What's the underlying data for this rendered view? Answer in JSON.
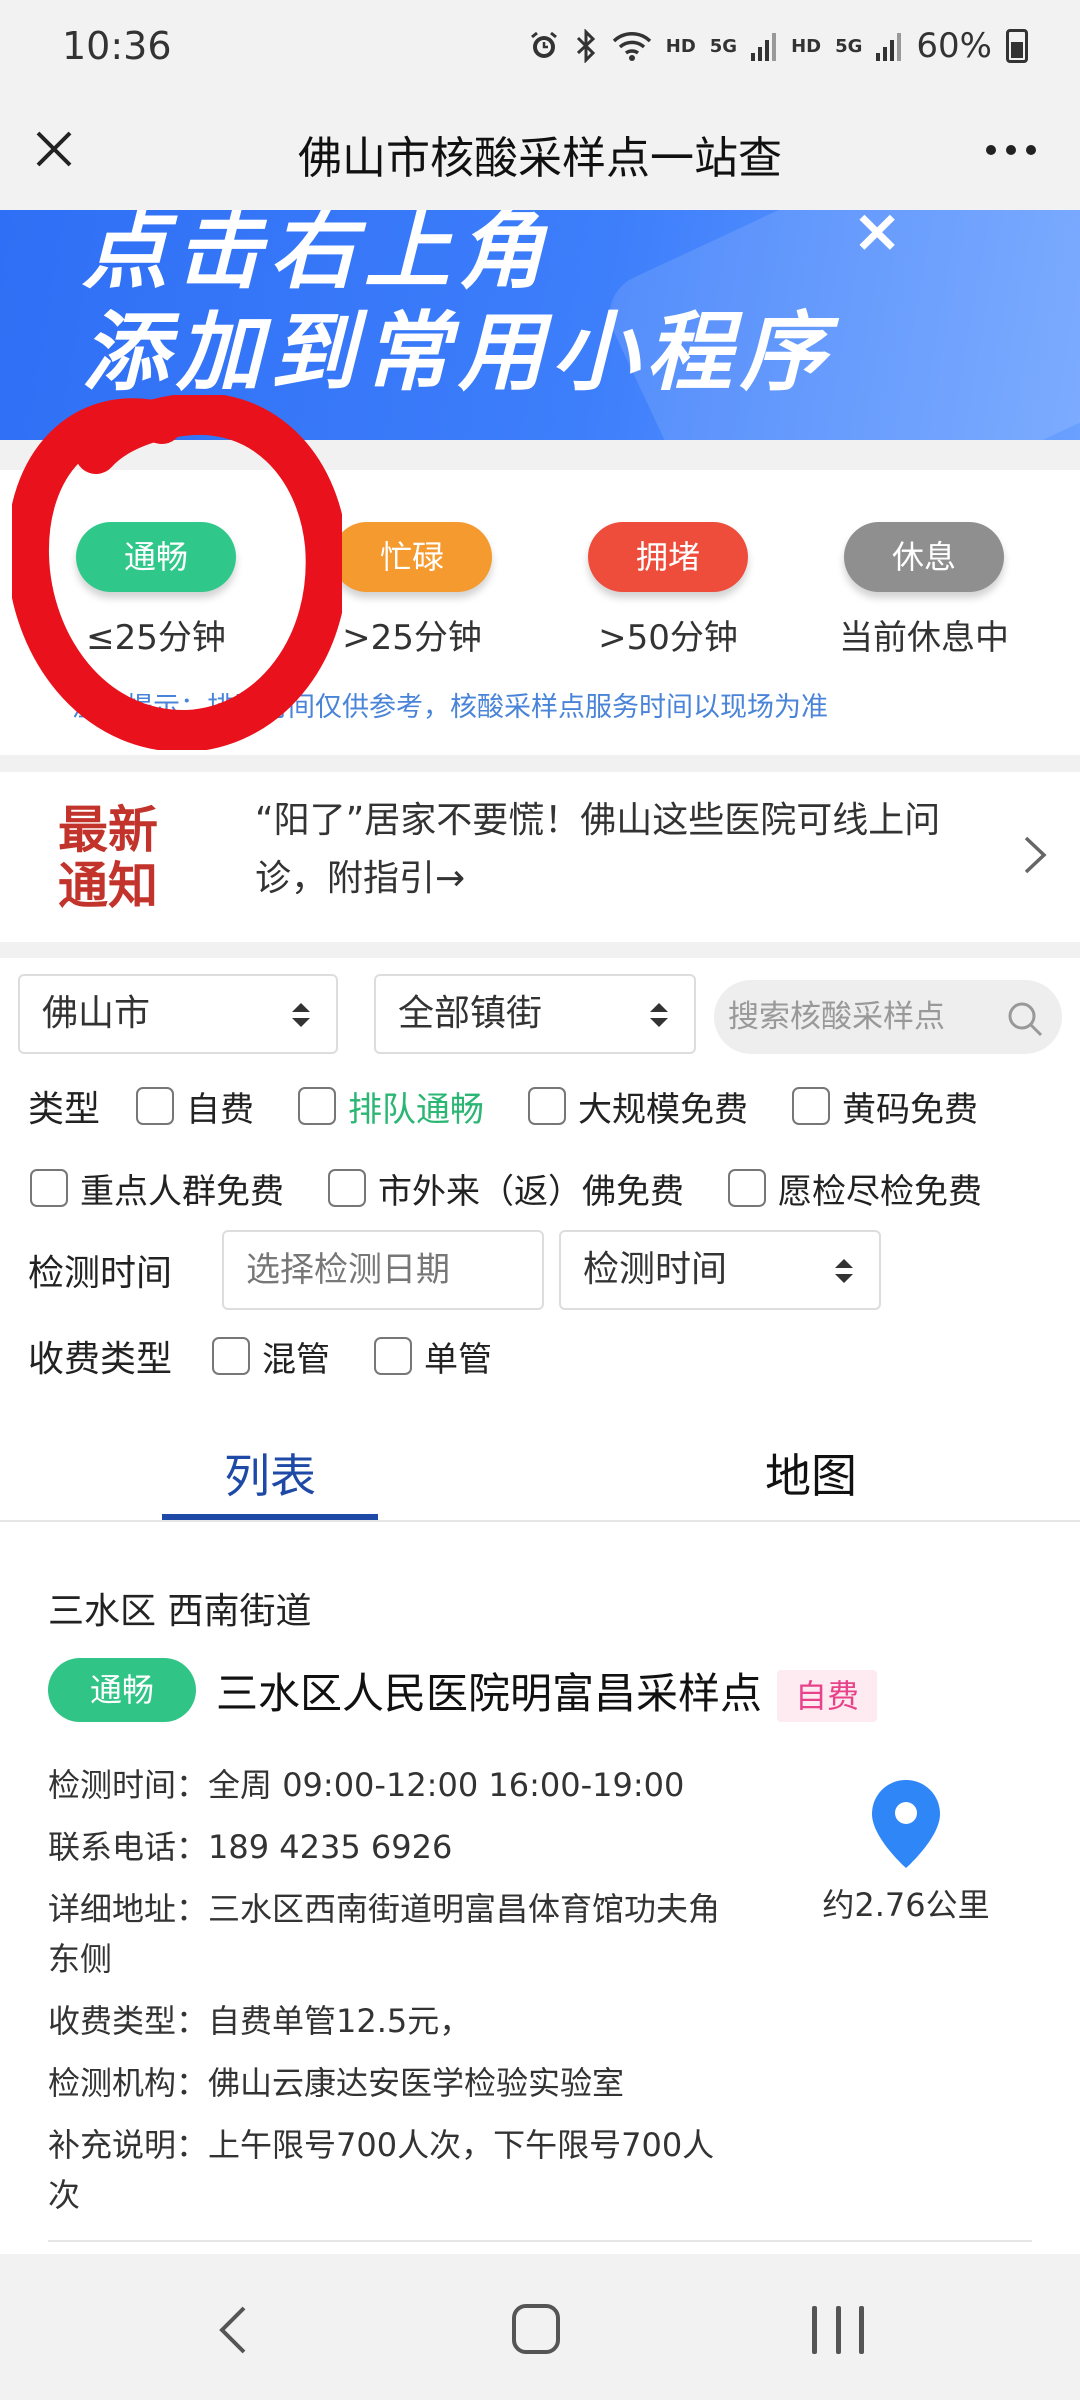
{
  "status_bar": {
    "time": "10:36",
    "network_labels": [
      "HD",
      "5G",
      "HD",
      "5G"
    ],
    "battery": "60%",
    "icons": [
      "alarm-icon",
      "bluetooth-icon",
      "wifi-icon",
      "signal-icon",
      "battery-icon"
    ]
  },
  "title_bar": {
    "title": "佛山市核酸采样点一站查"
  },
  "banner": {
    "line1": "点击右上角",
    "line2": "添加到常用小程序",
    "close": "×"
  },
  "legend": {
    "items": [
      {
        "label": "通畅",
        "time": "≤25分钟",
        "color": "#2fc88a"
      },
      {
        "label": "忙碌",
        "time": ">25分钟",
        "color": "#f59a2e"
      },
      {
        "label": "拥堵",
        "time": ">50分钟",
        "color": "#ee4d3c"
      },
      {
        "label": "休息",
        "time": "当前休息中",
        "color": "#8f8f8f"
      }
    ],
    "note": "温馨提示：排队时间仅供参考，核酸采样点服务时间以现场为准"
  },
  "notice": {
    "label_line1": "最新",
    "label_line2": "通知",
    "text": "“阳了”居家不要慌！佛山这些医院可线上问诊，附指引→"
  },
  "filters": {
    "city_select": "佛山市",
    "town_select": "全部镇街",
    "search_placeholder": "搜索核酸采样点",
    "type_label": "类型",
    "type_options": [
      "自费",
      "排队通畅",
      "大规模免费",
      "黄码免费"
    ],
    "type_options_row2": [
      "重点人群免费",
      "市外来（返）佛免费",
      "愿检尽检免费"
    ],
    "time_label": "检测时间",
    "date_placeholder": "选择检测日期",
    "time_select": "检测时间",
    "fee_label": "收费类型",
    "fee_options": [
      "混管",
      "单管"
    ]
  },
  "tabs": {
    "list": "列表",
    "map": "地图",
    "active": "列表"
  },
  "result": {
    "area": "三水区 西南街道",
    "status": "通畅",
    "name": "三水区人民医院明富昌采样点",
    "fee_badge": "自费",
    "rows": [
      {
        "label": "检测时间：",
        "value": "全周 09:00-12:00 16:00-19:00"
      },
      {
        "label": "联系电话：",
        "value": "189 4235 6926"
      },
      {
        "label": "详细地址：",
        "value": "三水区西南街道明富昌体育馆功夫角东侧"
      },
      {
        "label": "收费类型：",
        "value": "自费单管12.5元，"
      },
      {
        "label": "检测机构：",
        "value": "佛山云康达安医学检验实验室"
      },
      {
        "label": "补充说明：",
        "value": "上午限号700人次，下午限号700人次"
      }
    ],
    "distance": "约2.76公里"
  }
}
